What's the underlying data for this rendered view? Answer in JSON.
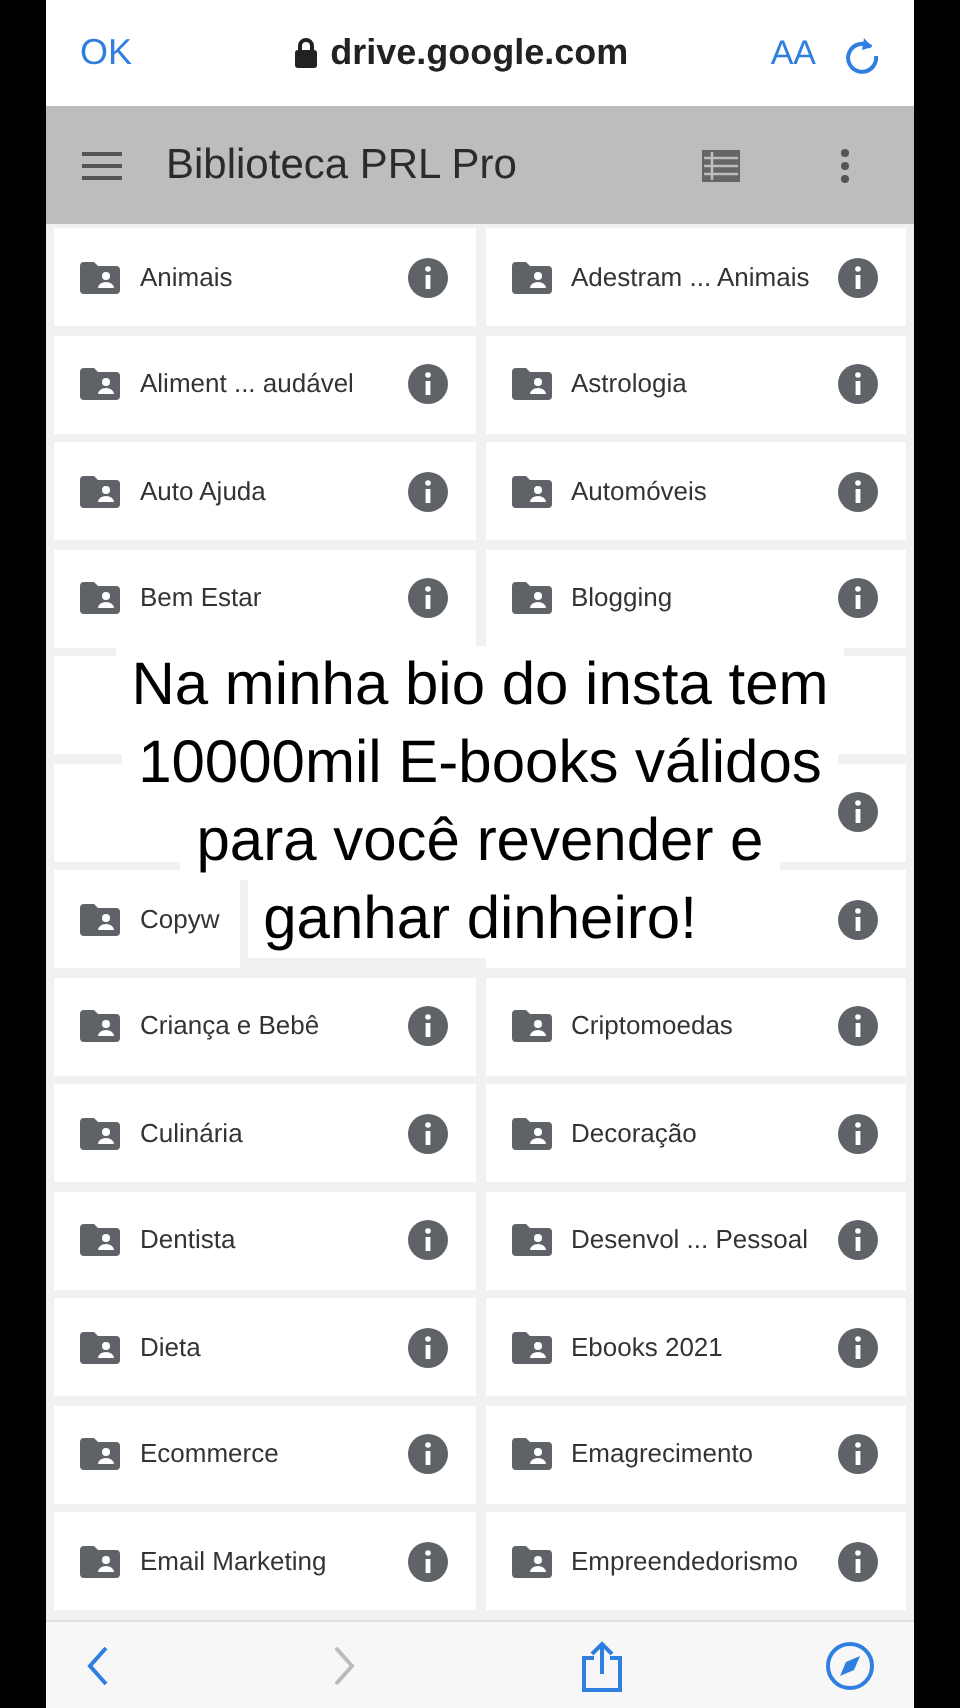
{
  "browser_bar": {
    "done_button": "OK",
    "url": "drive.google.com",
    "text_size_button": "AA"
  },
  "drive_header": {
    "title": "Biblioteca PRL Pro"
  },
  "folders": [
    {
      "kind": "folder",
      "label": "Animais"
    },
    {
      "kind": "folder",
      "label": "Adestram ... Animais"
    },
    {
      "kind": "folder",
      "label": "Aliment ... audável"
    },
    {
      "kind": "folder",
      "label": "Astrologia"
    },
    {
      "kind": "folder",
      "label": "Auto Ajuda"
    },
    {
      "kind": "folder",
      "label": "Automóveis"
    },
    {
      "kind": "folder",
      "label": "Bem Estar"
    },
    {
      "kind": "folder",
      "label": "Blogging"
    },
    {
      "kind": "blank"
    },
    {
      "kind": "blank"
    },
    {
      "kind": "blank"
    },
    {
      "kind": "info_only"
    },
    {
      "kind": "folder_partial",
      "label": "Copyw"
    },
    {
      "kind": "info_only"
    },
    {
      "kind": "folder",
      "label": "Criança e Bebê"
    },
    {
      "kind": "folder",
      "label": "Criptomoedas"
    },
    {
      "kind": "folder",
      "label": "Culinária"
    },
    {
      "kind": "folder",
      "label": "Decoração"
    },
    {
      "kind": "folder",
      "label": "Dentista"
    },
    {
      "kind": "folder",
      "label": "Desenvol ... Pessoal"
    },
    {
      "kind": "folder",
      "label": "Dieta"
    },
    {
      "kind": "folder",
      "label": "Ebooks 2021"
    },
    {
      "kind": "folder",
      "label": "Ecommerce"
    },
    {
      "kind": "folder",
      "label": "Emagrecimento"
    },
    {
      "kind": "folder",
      "label": "Email Marketing"
    },
    {
      "kind": "folder",
      "label": "Empreendedorismo"
    }
  ],
  "caption_lines": [
    "Na minha bio do insta tem",
    "10000mil E-books válidos",
    "para você revender e",
    "ganhar dinheiro!"
  ]
}
